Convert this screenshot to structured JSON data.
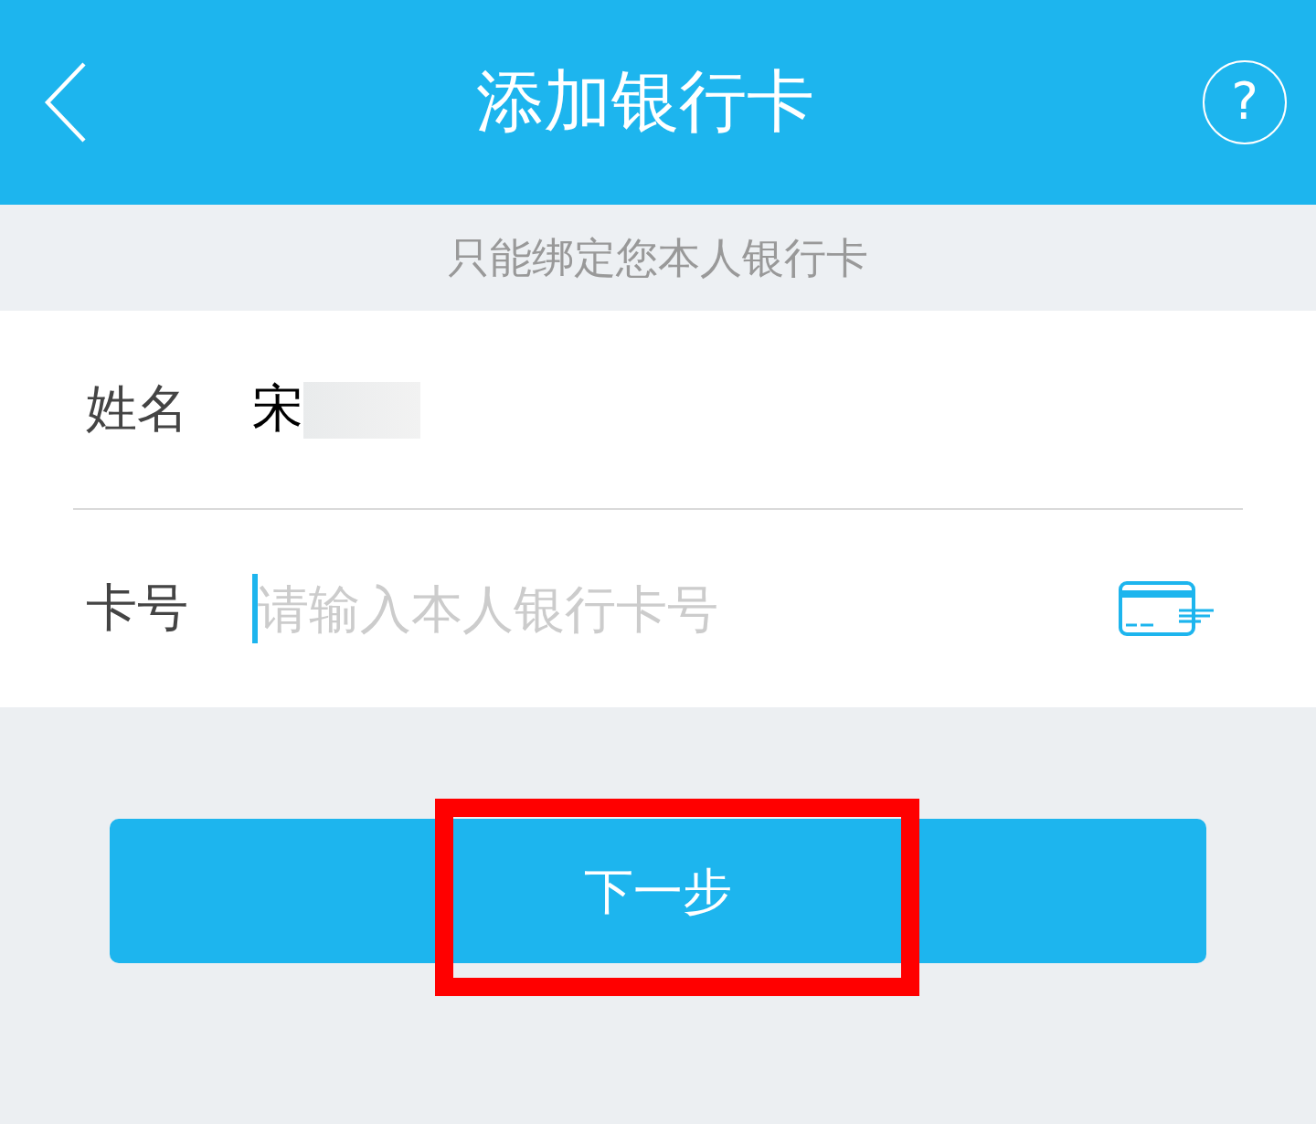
{
  "header": {
    "title": "添加银行卡",
    "help_button": {
      "label": "?"
    }
  },
  "notice": "只能绑定您本人银行卡",
  "form": {
    "rows": [
      {
        "kind": "text",
        "label": "姓名",
        "value": "宋",
        "redacted": true
      },
      {
        "kind": "input",
        "label": "卡号",
        "placeholder": "请输入本人银行卡号",
        "focused": true,
        "card_icon": true
      }
    ]
  },
  "next_button": {
    "label": "下一步",
    "highlighted": true
  }
}
